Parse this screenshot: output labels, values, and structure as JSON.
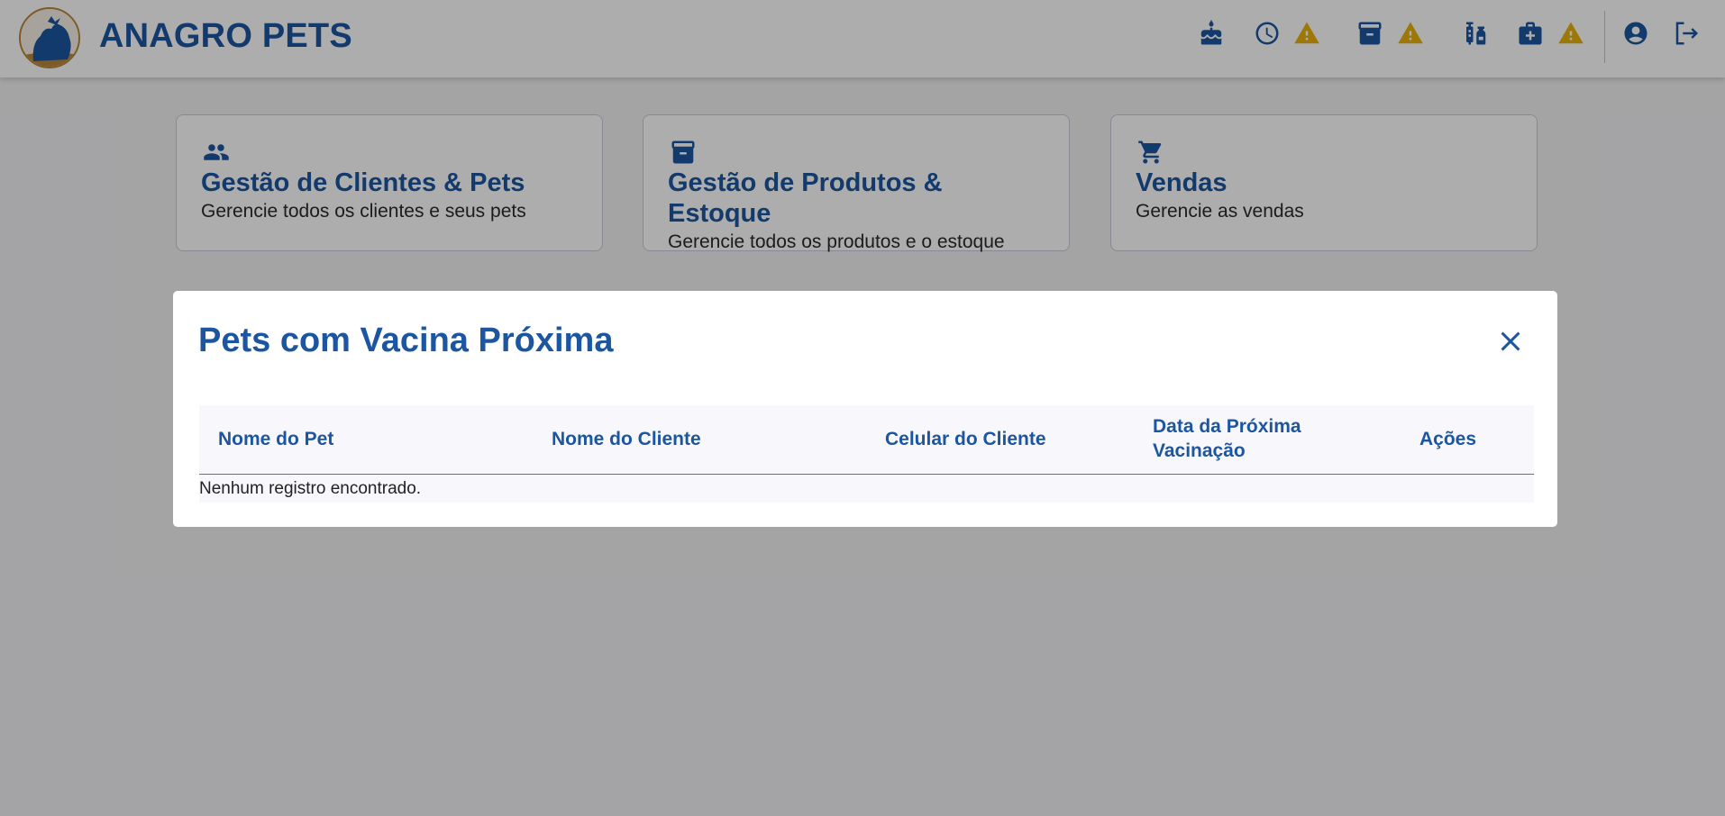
{
  "app": {
    "brand": "ANAGRO PETS"
  },
  "header_icons": [
    {
      "name": "cake-icon"
    },
    {
      "name": "clock-icon"
    },
    {
      "name": "warning-icon"
    },
    {
      "name": "archive-icon"
    },
    {
      "name": "warning-icon"
    },
    {
      "name": "vaccine-icon"
    },
    {
      "name": "medical-kit-icon"
    },
    {
      "name": "warning-icon"
    },
    {
      "name": "account-icon"
    },
    {
      "name": "logout-icon"
    }
  ],
  "cards": [
    {
      "icon": "people-icon",
      "title": "Gestão de Clientes & Pets",
      "description": "Gerencie todos os clientes e seus pets"
    },
    {
      "icon": "archive-icon",
      "title": "Gestão de Produtos & Estoque",
      "description": "Gerencie todos os produtos e o estoque"
    },
    {
      "icon": "cart-icon",
      "title": "Vendas",
      "description": "Gerencie as vendas"
    }
  ],
  "modal": {
    "title": "Pets com Vacina Próxima",
    "columns": [
      "Nome do Pet",
      "Nome do Cliente",
      "Celular do Cliente",
      "Data da Próxima Vacinação",
      "Ações"
    ],
    "empty_message": "Nenhum registro encontrado."
  },
  "colors": {
    "primary": "#1c56a0",
    "warning": "#e8b10a",
    "logo_ring": "#b8873a"
  }
}
